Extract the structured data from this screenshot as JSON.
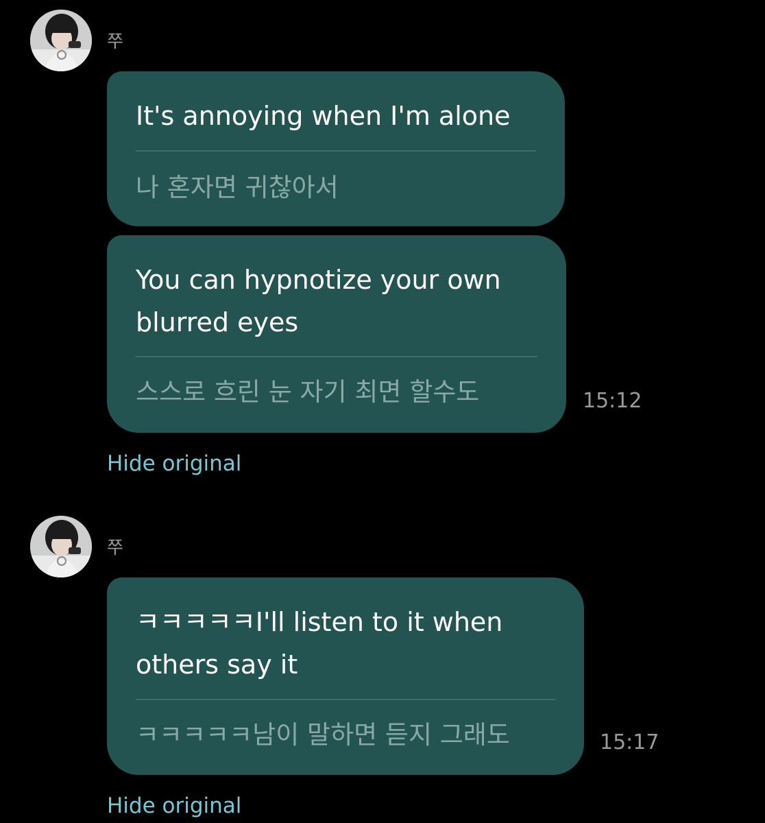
{
  "groups": [
    {
      "sender": "쭈",
      "avatar_icon": "profile-photo",
      "messages": [
        {
          "translated": "It's annoying when I'm alone",
          "original": "나 혼자면 귀찮아서"
        },
        {
          "translated": "You can hypnotize your own\nblurred eyes",
          "original": "스스로 흐린 눈 자기 최면 할수도",
          "time": "15:12"
        }
      ],
      "hide_original_label": "Hide original"
    },
    {
      "sender": "쭈",
      "avatar_icon": "profile-photo",
      "messages": [
        {
          "translated": "ㅋㅋㅋㅋㅋI'll listen to it when\nothers say it",
          "original": "ㅋㅋㅋㅋㅋ남이 말하면 듣지 그래도",
          "time": "15:17"
        }
      ],
      "hide_original_label": "Hide original"
    }
  ],
  "colors": {
    "background": "#000000",
    "bubble": "#235451",
    "original_text": "#88a9a6",
    "link": "#79c7d6",
    "meta_text": "#9a9a9a"
  }
}
